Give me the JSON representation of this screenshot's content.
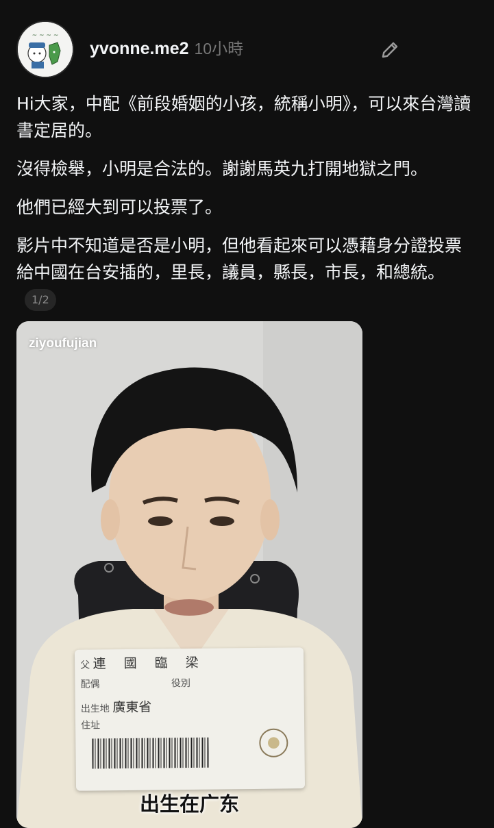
{
  "post": {
    "username": "yvonne.me2",
    "timestamp": "10小時",
    "paragraphs": [
      "Hi大家，中配《前段婚姻的小孩，統稱小明》，可以來台灣讀書定居的。",
      "沒得檢舉，小明是合法的。謝謝馬英九打開地獄之門。",
      "他們已經大到可以投票了。"
    ],
    "last_paragraph": "影片中不知道是否是小明，但他看起來可以憑藉身分證投票給中國在台安插的，里長，議員，縣長，市長，和總統。",
    "page_indicator": "1/2"
  },
  "media": {
    "watermark": "ziyoufujian",
    "caption": "出生在广东",
    "id_card": {
      "father_label": "父",
      "father_value": "連 國 臨 梁",
      "spouse_label": "配偶",
      "service_label": "役別",
      "birthplace_label": "出生地",
      "birthplace_value": "廣東省",
      "address_label": "住址"
    }
  },
  "icons": {
    "edit": "pencil-icon",
    "avatar": "avatar-illustration"
  },
  "colors": {
    "background": "#101010",
    "text": "#f3f5f7",
    "muted": "#777777"
  }
}
